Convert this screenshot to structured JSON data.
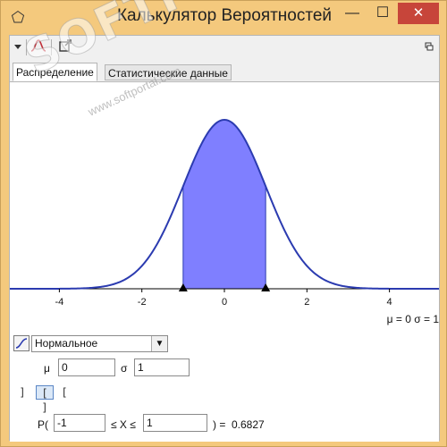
{
  "window": {
    "title": "Калькулятор Вероятностей",
    "minimize": "—",
    "maximize": "☐",
    "close": "✕"
  },
  "toolbar": {
    "menu_icon": "chevron-down-icon",
    "distribution_icon": "normal-curve-icon",
    "export_icon": "export-icon",
    "dock_icon": "dock-icon"
  },
  "tabs": [
    {
      "label": "Распределение",
      "active": true
    },
    {
      "label": "Статистические данные",
      "active": false
    }
  ],
  "plot": {
    "x_ticks": [
      "-4",
      "-2",
      "0",
      "2",
      "4"
    ],
    "params_text": "μ = 0   σ = 1",
    "curve_color": "#2b3bb0",
    "fill_color": "#7f7fff"
  },
  "chart_data": {
    "type": "area",
    "function": "normal pdf",
    "mean": 0,
    "sd": 1,
    "xlim": [
      -5.2,
      5.2
    ],
    "x_ticks": [
      -4,
      -2,
      0,
      2,
      4
    ],
    "shaded_interval": [
      -1,
      1
    ],
    "shaded_probability": 0.6827,
    "grid": false
  },
  "controls": {
    "distribution": "Нормальное",
    "mu_label": "μ",
    "mu_value": "0",
    "sigma_label": "σ",
    "sigma_value": "1",
    "interval_left_label": "]",
    "interval_two_label": "[ ]",
    "interval_right_label": "[",
    "p_open": "P(",
    "lower_value": "-1",
    "le_x_le": "≤ X ≤",
    "upper_value": "1",
    "result_prefix": ") =",
    "result_value": "0.6827"
  },
  "watermark": {
    "brand": "SOFTPORTAL",
    "url": "www.softportal.com"
  },
  "colors": {
    "frame": "#f4c97d",
    "close_button": "#c7453a",
    "accent_selection": "#5a86c5"
  }
}
